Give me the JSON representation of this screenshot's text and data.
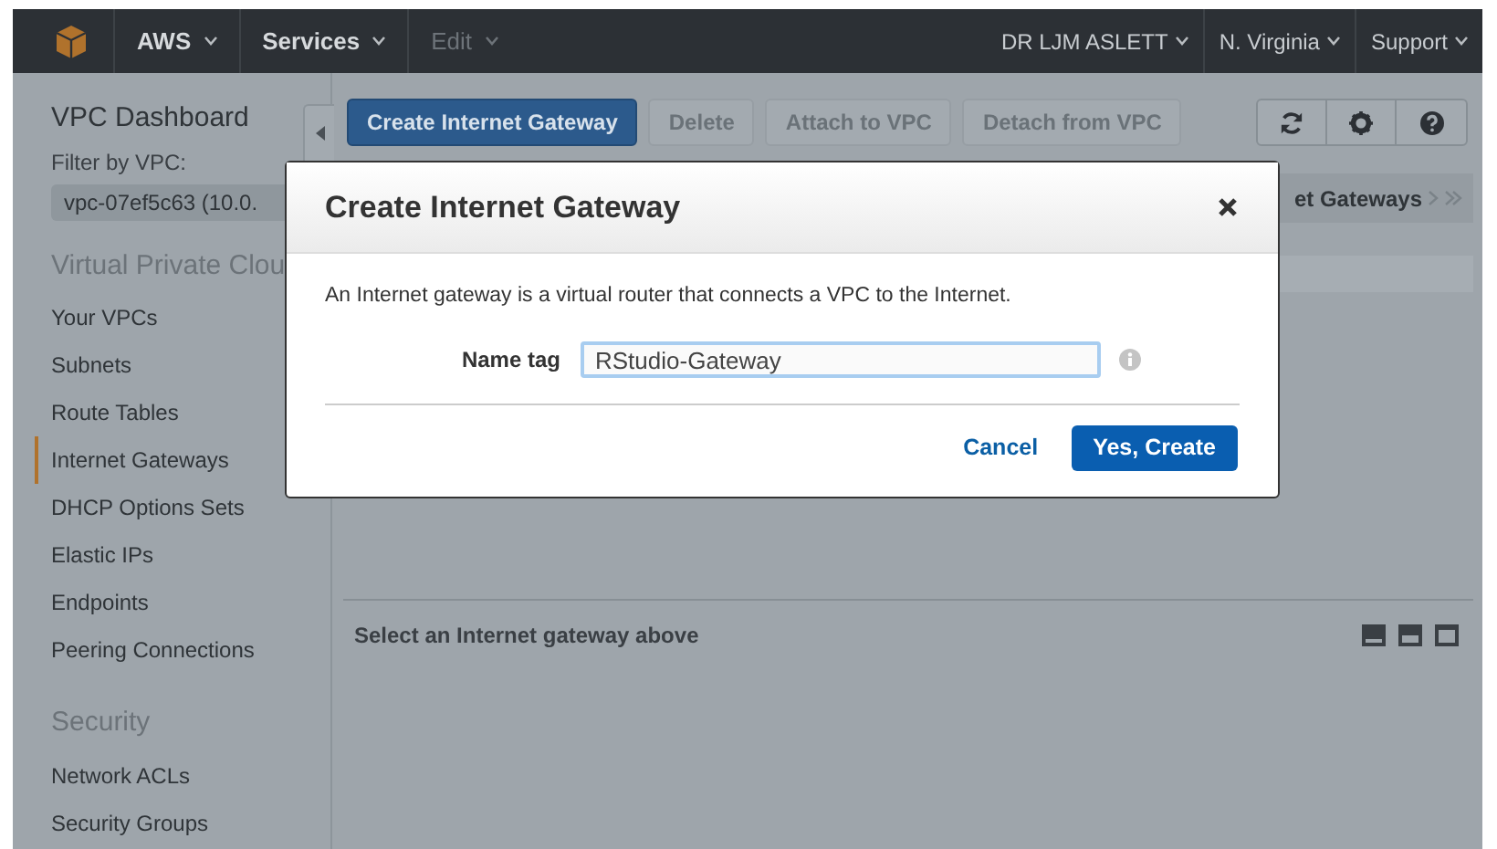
{
  "top_nav": {
    "left_items": [
      {
        "label": "AWS",
        "disabled": false
      },
      {
        "label": "Services",
        "disabled": false
      },
      {
        "label": "Edit",
        "disabled": true
      }
    ],
    "right_items": [
      {
        "label": "DR LJM ASLETT"
      },
      {
        "label": "N. Virginia"
      },
      {
        "label": "Support"
      }
    ]
  },
  "sidebar": {
    "title": "VPC Dashboard",
    "filter_label": "Filter by VPC:",
    "filter_value": "vpc-07ef5c63 (10.0.",
    "sections": [
      {
        "heading": "Virtual Private Clou",
        "items": [
          {
            "label": "Your VPCs",
            "selected": false
          },
          {
            "label": "Subnets",
            "selected": false
          },
          {
            "label": "Route Tables",
            "selected": false
          },
          {
            "label": "Internet Gateways",
            "selected": true
          },
          {
            "label": "DHCP Options Sets",
            "selected": false
          },
          {
            "label": "Elastic IPs",
            "selected": false
          },
          {
            "label": "Endpoints",
            "selected": false
          },
          {
            "label": "Peering Connections",
            "selected": false
          }
        ]
      },
      {
        "heading": "Security",
        "items": [
          {
            "label": "Network ACLs",
            "selected": false
          },
          {
            "label": "Security Groups",
            "selected": false
          }
        ]
      }
    ]
  },
  "toolbar": {
    "buttons": [
      {
        "label": "Create Internet Gateway",
        "disabled": false
      },
      {
        "label": "Delete",
        "disabled": true
      },
      {
        "label": "Attach to VPC",
        "disabled": true
      },
      {
        "label": "Detach from VPC",
        "disabled": true
      }
    ]
  },
  "breadcrumb": "et Gateways",
  "details_panel": {
    "message": "Select an Internet gateway above"
  },
  "dialog": {
    "title": "Create Internet Gateway",
    "description": "An Internet gateway is a virtual router that connects a VPC to the Internet.",
    "field_label": "Name tag",
    "field_value": "RStudio-Gateway",
    "cancel": "Cancel",
    "confirm": "Yes, Create"
  }
}
